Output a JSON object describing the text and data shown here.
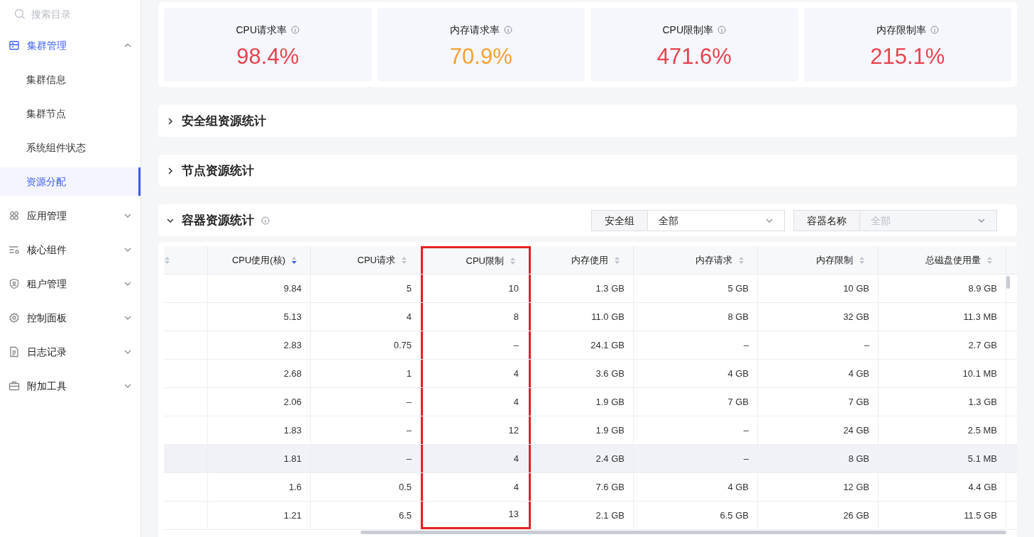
{
  "sidebar": {
    "search": {
      "placeholder": "搜索目录"
    },
    "groups": [
      {
        "label": "集群管理",
        "expanded": true,
        "active": true,
        "children": [
          {
            "label": "集群信息",
            "selected": false
          },
          {
            "label": "集群节点",
            "selected": false
          },
          {
            "label": "系统组件状态",
            "selected": false
          },
          {
            "label": "资源分配",
            "selected": true
          }
        ]
      },
      {
        "label": "应用管理",
        "expanded": false,
        "active": false
      },
      {
        "label": "核心组件",
        "expanded": false,
        "active": false
      },
      {
        "label": "租户管理",
        "expanded": false,
        "active": false
      },
      {
        "label": "控制面板",
        "expanded": false,
        "active": false
      },
      {
        "label": "日志记录",
        "expanded": false,
        "active": false
      },
      {
        "label": "附加工具",
        "expanded": false,
        "active": false
      }
    ]
  },
  "stats": [
    {
      "label": "CPU请求率",
      "value": "98.4%",
      "color": "#e8434f"
    },
    {
      "label": "内存请求率",
      "value": "70.9%",
      "color": "#f6a035"
    },
    {
      "label": "CPU限制率",
      "value": "471.6%",
      "color": "#e8434f"
    },
    {
      "label": "内存限制率",
      "value": "215.1%",
      "color": "#e8434f"
    }
  ],
  "sections": [
    {
      "title": "安全组资源统计",
      "expanded": false
    },
    {
      "title": "节点资源统计",
      "expanded": false
    },
    {
      "title": "容器资源统计",
      "expanded": true,
      "info": true
    }
  ],
  "filters": [
    {
      "label": "安全组",
      "value": "全部",
      "disabled": false
    },
    {
      "label": "容器名称",
      "value": "全部",
      "disabled": true
    }
  ],
  "table": {
    "columns": [
      {
        "label": "CPU使用(核)",
        "sorted": true,
        "highlighted": false
      },
      {
        "label": "CPU请求",
        "sorted": false,
        "highlighted": false
      },
      {
        "label": "CPU限制",
        "sorted": false,
        "highlighted": true
      },
      {
        "label": "内存使用",
        "sorted": false,
        "highlighted": false
      },
      {
        "label": "内存请求",
        "sorted": false,
        "highlighted": false
      },
      {
        "label": "内存限制",
        "sorted": false,
        "highlighted": false
      },
      {
        "label": "总磁盘使用量",
        "sorted": false,
        "highlighted": false
      }
    ],
    "rows": [
      {
        "hovered": false,
        "cells": [
          "9.84",
          "5",
          "10",
          "1.3 GB",
          "5 GB",
          "10 GB",
          "8.9 GB"
        ]
      },
      {
        "hovered": false,
        "cells": [
          "5.13",
          "4",
          "8",
          "11.0 GB",
          "8 GB",
          "32 GB",
          "11.3 MB"
        ]
      },
      {
        "hovered": false,
        "cells": [
          "2.83",
          "0.75",
          "–",
          "24.1 GB",
          "–",
          "–",
          "2.7 GB"
        ]
      },
      {
        "hovered": false,
        "cells": [
          "2.68",
          "1",
          "4",
          "3.6 GB",
          "4 GB",
          "4 GB",
          "10.1 MB"
        ]
      },
      {
        "hovered": false,
        "cells": [
          "2.06",
          "–",
          "4",
          "1.9 GB",
          "7 GB",
          "7 GB",
          "1.3 GB"
        ]
      },
      {
        "hovered": false,
        "cells": [
          "1.83",
          "–",
          "12",
          "1.9 GB",
          "–",
          "24 GB",
          "2.5 MB"
        ]
      },
      {
        "hovered": true,
        "cells": [
          "1.81",
          "–",
          "4",
          "2.4 GB",
          "–",
          "8 GB",
          "5.1 MB"
        ]
      },
      {
        "hovered": false,
        "cells": [
          "1.6",
          "0.5",
          "4",
          "7.6 GB",
          "4 GB",
          "12 GB",
          "4.4 GB"
        ]
      },
      {
        "hovered": false,
        "cells": [
          "1.21",
          "6.5",
          "13",
          "2.1 GB",
          "6.5 GB",
          "26 GB",
          "11.5 GB"
        ]
      }
    ]
  }
}
